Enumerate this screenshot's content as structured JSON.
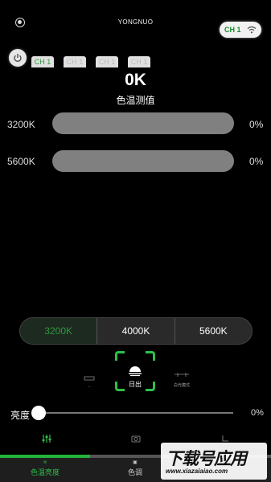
{
  "header": {
    "title": "YONGNUO",
    "channel_pill": "CH 1",
    "icons": {
      "settings": "gear-icon",
      "wifi": "wifi-icon",
      "power": "power-icon"
    }
  },
  "channel_tabs": [
    "CH 1",
    "CH 1",
    "CH 1",
    "CH 1"
  ],
  "measurement": {
    "value": "0K",
    "label": "色温测值"
  },
  "levels": [
    {
      "label": "3200K",
      "percent_text": "0%",
      "level": 0
    },
    {
      "label": "5600K",
      "percent_text": "0%",
      "level": 0
    }
  ],
  "presets": {
    "options": [
      "3200K",
      "4000K",
      "5600K"
    ],
    "selected": "3200K"
  },
  "scene": {
    "left_label": "···",
    "center_label": "日出",
    "right_label": "白光模式"
  },
  "brightness": {
    "label": "亮度",
    "percent_text": "0%",
    "level": 0
  },
  "bottom_nav": {
    "tabs": [
      {
        "label": "色温亮度",
        "icon": "sliders-icon"
      },
      {
        "label": "色调",
        "icon": "palette-icon"
      }
    ]
  },
  "watermark": {
    "main": "下载号应用",
    "url": "www.xiazaiaiao.com"
  },
  "colors": {
    "accent": "#23b33a",
    "bar_track": "#808080",
    "background": "#000000"
  }
}
